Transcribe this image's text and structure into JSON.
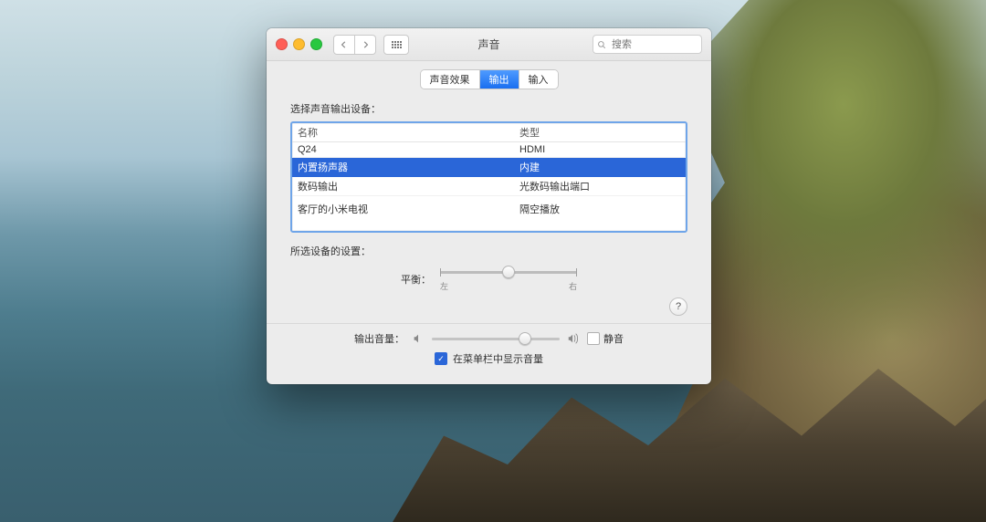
{
  "window": {
    "title": "声音",
    "search_placeholder": "搜索"
  },
  "tabs": {
    "effects": "声音效果",
    "output": "输出",
    "input": "输入"
  },
  "output": {
    "chooseLabel": "选择声音输出设备：",
    "columns": {
      "name": "名称",
      "type": "类型"
    },
    "devices": [
      {
        "name": "Q24",
        "type": "HDMI",
        "selected": false
      },
      {
        "name": "内置扬声器",
        "type": "内建",
        "selected": true
      },
      {
        "name": "数码输出",
        "type": "光数码输出端口",
        "selected": false
      },
      {
        "name": "客厅的小米电视",
        "type": "隔空播放",
        "selected": false
      }
    ],
    "settingsLabel": "所选设备的设置：",
    "balance": {
      "label": "平衡：",
      "left": "左",
      "right": "右"
    }
  },
  "volume": {
    "label": "输出音量：",
    "muteLabel": "静音",
    "mute": false,
    "showInMenuBar": true,
    "showInMenuBarLabel": "在菜单栏中显示音量"
  },
  "help_label": "?"
}
